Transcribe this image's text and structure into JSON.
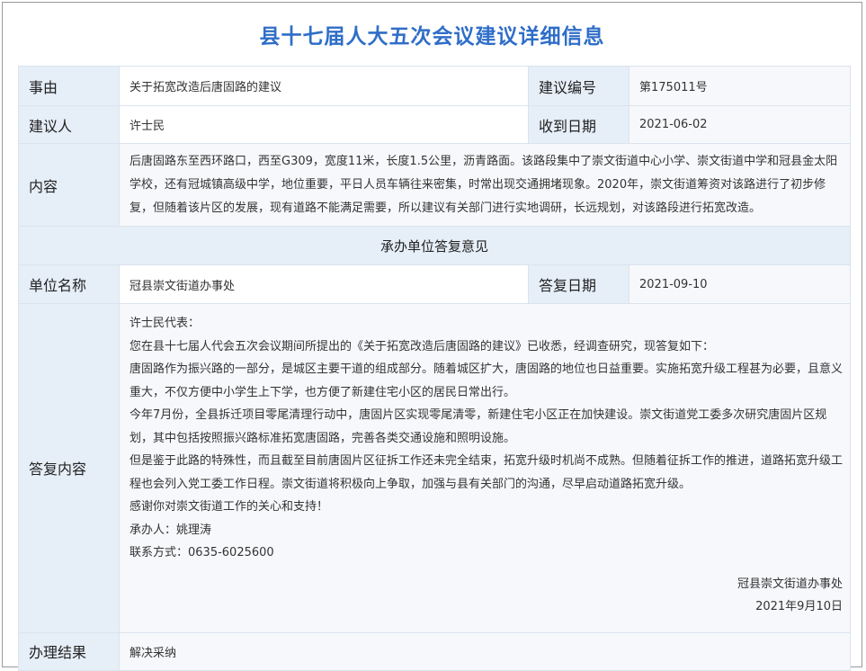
{
  "page": {
    "title": "县十七届人大五次会议建议详细信息"
  },
  "rows": {
    "subject_label": "事由",
    "subject_value": "关于拓宽改造后唐固路的建议",
    "number_label": "建议编号",
    "number_value": "第175011号",
    "proposer_label": "建议人",
    "proposer_value": "许士民",
    "received_label": "收到日期",
    "received_value": "2021-06-02",
    "content_label": "内容",
    "content_value": "后唐固路东至西环路口，西至G309，宽度11米，长度1.5公里，沥青路面。该路段集中了崇文街道中心小学、崇文街道中学和冠县金太阳学校，还有冠城镇高级中学，地位重要，平日人员车辆往来密集，时常出现交通拥堵现象。2020年，崇文街道筹资对该路进行了初步修复，但随着该片区的发展，现有道路不能满足需要，所以建议有关部门进行实地调研，长远规划，对该路段进行拓宽改造。"
  },
  "section": {
    "heading": "承办单位答复意见"
  },
  "reply": {
    "unit_label": "单位名称",
    "unit_value": "冠县崇文街道办事处",
    "date_label": "答复日期",
    "date_value": "2021-09-10",
    "content_label": "答复内容",
    "paragraphs": [
      "许士民代表：",
      "您在县十七届人代会五次会议期间所提出的《关于拓宽改造后唐固路的建议》已收悉，经调查研究，现答复如下：",
      "唐固路作为振兴路的一部分，是城区主要干道的组成部分。随着城区扩大，唐固路的地位也日益重要。实施拓宽升级工程甚为必要，且意义重大，不仅方便中小学生上下学，也方便了新建住宅小区的居民日常出行。",
      "今年7月份，全县拆迁项目零尾清理行动中，唐固片区实现零尾清零，新建住宅小区正在加快建设。崇文街道党工委多次研究唐固片区规划，其中包括按照振兴路标准拓宽唐固路，完善各类交通设施和照明设施。",
      "但是鉴于此路的特殊性，而且截至目前唐固片区征拆工作还未完全结束，拓宽升级时机尚不成熟。但随着征拆工作的推进，道路拓宽升级工程也会列入党工委工作日程。崇文街道将积极向上争取，加强与县有关部门的沟通，尽早启动道路拓宽升级。",
      "感谢你对崇文街道工作的关心和支持！",
      "承办人：姚理涛",
      "联系方式：0635-6025600"
    ],
    "signature_org": "冠县崇文街道办事处",
    "signature_date": "2021年9月10日"
  },
  "result": {
    "label": "办理结果",
    "value": "解决采纳"
  }
}
